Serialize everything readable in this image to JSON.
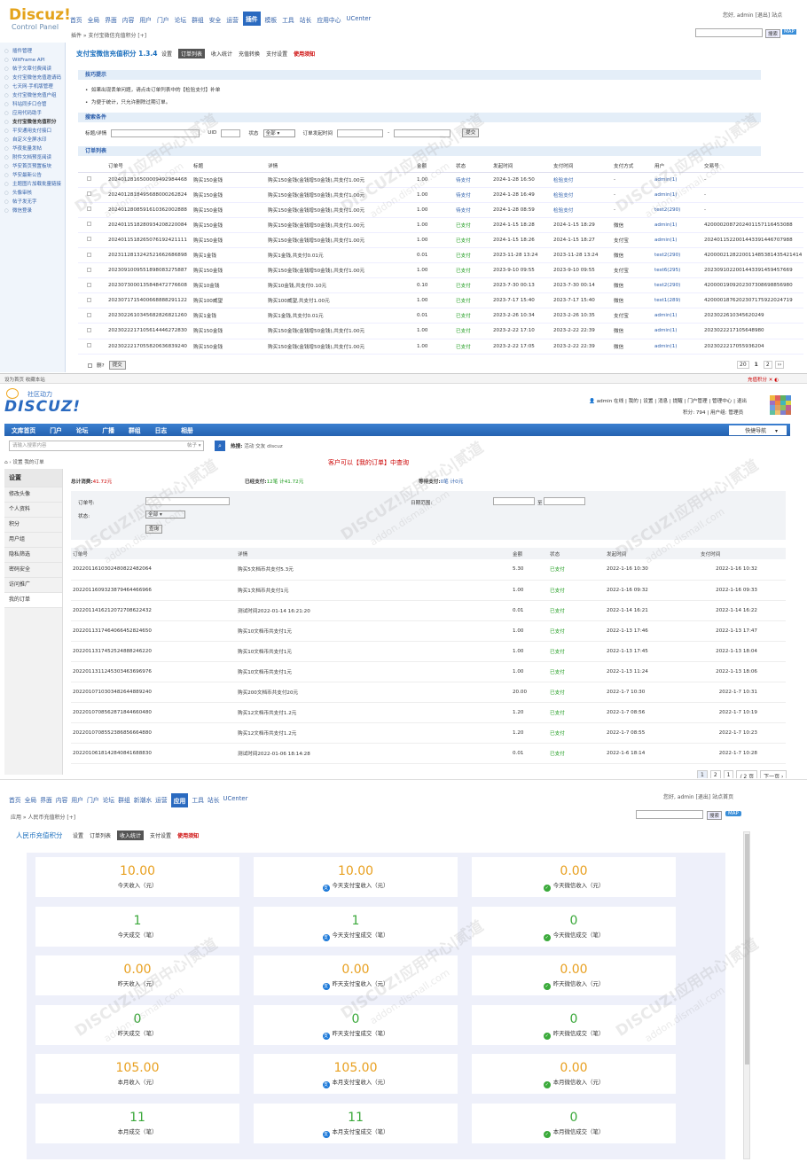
{
  "p1": {
    "logo": "Discuz!",
    "logo_sub": "Control Panel",
    "nav": [
      "首页",
      "全局",
      "界面",
      "内容",
      "用户",
      "门户",
      "论坛",
      "群组",
      "安全",
      "运营",
      "插件",
      "模板",
      "工具",
      "站长",
      "应用中心",
      "UCenter"
    ],
    "nav_active": "插件",
    "top_right": "您好, admin [退出] 站点",
    "breadcrumb": "插件 » 支付宝微信充值积分 [+]",
    "search_btn": "搜索",
    "map": "MAP",
    "sidebar": [
      "插件管理",
      "WitFrame API",
      "帖子文章付费阅读",
      "支付宝微信充值邀请码",
      "七天网·手机版管理",
      "支付宝微信充值户组",
      "科站同步口仓管",
      "应用代码助手",
      "支付宝微信充值积分",
      "平安通用支付接口",
      "自定义全屏水印",
      "华夜批量发帖",
      "附件文档预览阅读",
      "华安首页预置板块",
      "华安最新公告",
      "主题图片加载批量链接",
      "头像审核",
      "帖子发无字",
      "微信登录"
    ],
    "sidebar_current": "支付宝微信充值积分",
    "plugin_title": "支付宝微信充值积分 1.3.4",
    "tabs": [
      "设置",
      "订单列表",
      "收入统计",
      "充值转换",
      "支付设置",
      "使用须知"
    ],
    "tab_active": "订单列表",
    "sec_tips": "技巧提示",
    "tips": [
      "如果出现丢单问题，请点击订单列表中的【检验支付】补单",
      "为便于统计，只允许删除过期订单。"
    ],
    "sec_search": "搜索条件",
    "form": {
      "title_label": "标题/详情",
      "uid_label": "UID",
      "status_label": "状态",
      "status_value": "全部",
      "time_label": "订单发起时间",
      "dash": "-",
      "submit": "提交"
    },
    "sec_list": "订单列表",
    "columns": [
      "订单号",
      "标题",
      "详情",
      "金额",
      "状态",
      "发起时间",
      "支付时间",
      "支付方式",
      "用户",
      "交易号"
    ],
    "rows": [
      [
        "2024012816500009492984468",
        "购买150金钱",
        "购买150金钱(金钱增50金钱),共支付1.00元",
        "1.00",
        "待支付",
        "2024-1-28 16:50",
        "检验支付",
        "-",
        "admin(1)",
        "-"
      ],
      [
        "2024012818495688000262824",
        "购买150金钱",
        "购买150金钱(金钱增50金钱),共支付1.00元",
        "1.00",
        "待支付",
        "2024-1-28 16:49",
        "检验支付",
        "-",
        "admin(1)",
        "-"
      ],
      [
        "2024012808591610362002888",
        "购买150金钱",
        "购买150金钱(金钱增50金钱),共支付1.00元",
        "1.00",
        "待支付",
        "2024-1-28 08:59",
        "检验支付",
        "-",
        "test2(290)",
        "-"
      ],
      [
        "2024011518280934208220084",
        "购买150金钱",
        "购买150金钱(金钱增50金钱),共支付1.00元",
        "1.00",
        "已支付",
        "2024-1-15 18:28",
        "2024-1-15 18:29",
        "微信",
        "admin(1)",
        "4200002087202401157116453088"
      ],
      [
        "2024011518265076192421111",
        "购买150金钱",
        "购买150金钱(金钱增50金钱),共支付1.00元",
        "1.00",
        "已支付",
        "2024-1-15 18:26",
        "2024-1-15 18:27",
        "支付宝",
        "admin(1)",
        "2024011522001443391446707988"
      ],
      [
        "2023112813242521662686898",
        "购买1金钱",
        "购买1金钱,共支付0.01元",
        "0.01",
        "已支付",
        "2023-11-28 13:24",
        "2023-11-28 13:24",
        "微信",
        "test2(290)",
        "4200002128220011485381435421414"
      ],
      [
        "2023091009551898083275887",
        "购买150金钱",
        "购买150金钱(金钱增50金钱),共支付1.00元",
        "1.00",
        "已支付",
        "2023-9-10 09:55",
        "2023-9-10 09:55",
        "支付宝",
        "test6(295)",
        "2023091022001443391459457669"
      ],
      [
        "2023073000135848472776608",
        "购买10金钱",
        "购买10金钱,共支付0.10元",
        "0.10",
        "已支付",
        "2023-7-30 00:13",
        "2023-7-30 00:14",
        "微信",
        "test2(290)",
        "4200001909202307308698856980"
      ],
      [
        "2023071715400668888291122",
        "购买100威望",
        "购买100威望,共支付1.00元",
        "1.00",
        "已支付",
        "2023-7-17 15:40",
        "2023-7-17 15:40",
        "微信",
        "test1(289)",
        "4200001876202307175922024719"
      ],
      [
        "2023022610345682826821260",
        "购买1金钱",
        "购买1金钱,共支付0.01元",
        "0.01",
        "已支付",
        "2023-2-26 10:34",
        "2023-2-26 10:35",
        "支付宝",
        "admin(1)",
        "2023022610345620249"
      ],
      [
        "2023022217105614446272830",
        "购买150金钱",
        "购买150金钱(金钱增50金钱),共支付1.00元",
        "1.00",
        "已支付",
        "2023-2-22 17:10",
        "2023-2-22 22:39",
        "微信",
        "admin(1)",
        "2023022217105648980"
      ],
      [
        "2023022217055820636839240",
        "购买150金钱",
        "购买150金钱(金钱增50金钱),共支付1.00元",
        "1.00",
        "已支付",
        "2023-2-22 17:05",
        "2023-2-22 22:39",
        "微信",
        "admin(1)",
        "2023022217055936204"
      ]
    ],
    "footer_del": "删?",
    "footer_submit": "提交",
    "pages": [
      "20",
      "1",
      "2",
      "››"
    ]
  },
  "p2": {
    "topbar_left": "设为首页  收藏本站",
    "topbar_right": "充值积分",
    "logo_small": "社区动力",
    "logo": "DISCUZ!",
    "user_line": "admin 在线 | 我的 | 设置 | 消息 | 提醒 | 门户管理 | 管理中心 | 退出",
    "user_line2": "积分: 794 | 用户组: 管理员",
    "nav": [
      "文库首页",
      "门户",
      "论坛",
      "广播",
      "群组",
      "日志",
      "相册"
    ],
    "quick_nav": "快捷导航",
    "search_placeholder": "请输入搜索内容",
    "search_type": "帖子",
    "hot_label": "热搜:",
    "hot_items": "活动 交友 discuz",
    "breadcrumb": "设置  我的订单",
    "notice": "客户可以【我的订单】中查询",
    "sidebar_title": "设置",
    "sidebar": [
      "修改头像",
      "个人资料",
      "积分",
      "用户组",
      "隐私筛选",
      "密码安全",
      "访问推广",
      "我的订单"
    ],
    "sidebar_current": "我的订单",
    "sum_total_label": "总计消费:",
    "sum_total": "41.72元",
    "sum_paid_label": "已经支付:",
    "sum_paid": "12笔 计41.72元",
    "sum_wait_label": "等待支付:",
    "sum_wait": "0笔 计0元",
    "form": {
      "order_label": "订单号:",
      "status_label": "状态:",
      "status_value": "全部",
      "query": "查询",
      "date_label": "日期范围:",
      "to": "至"
    },
    "columns": [
      "订单号",
      "详情",
      "金额",
      "状态",
      "发起时间",
      "支付时间"
    ],
    "rows": [
      [
        "2022011610302480822482064",
        "购买5文档币共支付5.3元",
        "5.30",
        "已支付",
        "2022-1-16 10:30",
        "2022-1-16 10:32"
      ],
      [
        "2022011609323879464466966",
        "购买1文档币共支付1元",
        "1.00",
        "已支付",
        "2022-1-16 09:32",
        "2022-1-16 09:33"
      ],
      [
        "2022011416212072708622432",
        "测试时间2022-01-14 16:21:20",
        "0.01",
        "已支付",
        "2022-1-14 16:21",
        "2022-1-14 16:22"
      ],
      [
        "2022011317464066452824650",
        "购买10文档币共支付1元",
        "1.00",
        "已支付",
        "2022-1-13 17:46",
        "2022-1-13 17:47"
      ],
      [
        "2022011317452524888246220",
        "购买10文档币共支付1元",
        "1.00",
        "已支付",
        "2022-1-13 17:45",
        "2022-1-13 18:04"
      ],
      [
        "2022011311245303463696976",
        "购买10文档币共支付1元",
        "1.00",
        "已支付",
        "2022-1-13 11:24",
        "2022-1-13 18:06"
      ],
      [
        "2022010710303482644889240",
        "购买200文档币共支付20元",
        "20.00",
        "已支付",
        "2022-1-7 10:30",
        "2022-1-7 10:31"
      ],
      [
        "2022010708562871844660480",
        "购买12文档币共支付1.2元",
        "1.20",
        "已支付",
        "2022-1-7 08:56",
        "2022-1-7 10:19"
      ],
      [
        "2022010708552386856664880",
        "购买12文档币共支付1.2元",
        "1.20",
        "已支付",
        "2022-1-7 08:55",
        "2022-1-7 10:23"
      ],
      [
        "2022010618142840841688830",
        "测试时间2022-01-06 18:14:28",
        "0.01",
        "已支付",
        "2022-1-6 18:14",
        "2022-1-7 10:28"
      ]
    ],
    "pages": [
      "1",
      "2",
      "1",
      "/ 2 页",
      "下一页 ›"
    ]
  },
  "p3": {
    "nav": [
      "首页",
      "全局",
      "界面",
      "内容",
      "用户",
      "门户",
      "论坛",
      "群组",
      "新潮水",
      "运营",
      "应用",
      "工具",
      "站长",
      "UCenter"
    ],
    "nav_active": "应用",
    "top_right": "您好, admin [退出] 站点首页",
    "breadcrumb": "应用 » 人民币充值积分 [+]",
    "search_btn": "搜索",
    "map": "MAP",
    "plugin_title": "人民币充值积分",
    "tabs": [
      "设置",
      "订单列表",
      "收入统计",
      "支付设置",
      "使用须知"
    ],
    "tab_active": "收入统计",
    "cards": [
      {
        "v": "10.00",
        "l": "今天收入（元）",
        "icon": ""
      },
      {
        "v": "10.00",
        "l": "今天支付宝收入（元）",
        "icon": "alipay-icon"
      },
      {
        "v": "0.00",
        "l": "今天微信收入（元）",
        "icon": "wechat-icon"
      },
      {
        "v": "1",
        "l": "今天成交（笔）",
        "icon": ""
      },
      {
        "v": "1",
        "l": "今天支付宝成交（笔）",
        "icon": "alipay-icon"
      },
      {
        "v": "0",
        "l": "今天微信成交（笔）",
        "icon": "wechat-icon"
      },
      {
        "v": "0.00",
        "l": "昨天收入（元）",
        "icon": ""
      },
      {
        "v": "0.00",
        "l": "昨天支付宝收入（元）",
        "icon": "alipay-icon"
      },
      {
        "v": "0.00",
        "l": "昨天微信收入（元）",
        "icon": "wechat-icon"
      },
      {
        "v": "0",
        "l": "昨天成交（笔）",
        "icon": ""
      },
      {
        "v": "0",
        "l": "昨天支付宝成交（笔）",
        "icon": "alipay-icon"
      },
      {
        "v": "0",
        "l": "昨天微信成交（笔）",
        "icon": "wechat-icon"
      },
      {
        "v": "105.00",
        "l": "本月收入（元）",
        "icon": ""
      },
      {
        "v": "105.00",
        "l": "本月支付宝收入（元）",
        "icon": "alipay-icon"
      },
      {
        "v": "0.00",
        "l": "本月微信收入（元）",
        "icon": "wechat-icon"
      },
      {
        "v": "11",
        "l": "本月成交（笔）",
        "icon": ""
      },
      {
        "v": "11",
        "l": "本月支付宝成交（笔）",
        "icon": "alipay-icon"
      },
      {
        "v": "0",
        "l": "本月微信成交（笔）",
        "icon": "wechat-icon"
      }
    ]
  },
  "watermark": {
    "text": "DISCUZ!应用中心|贰道",
    "url": "addon.dismall.com"
  }
}
